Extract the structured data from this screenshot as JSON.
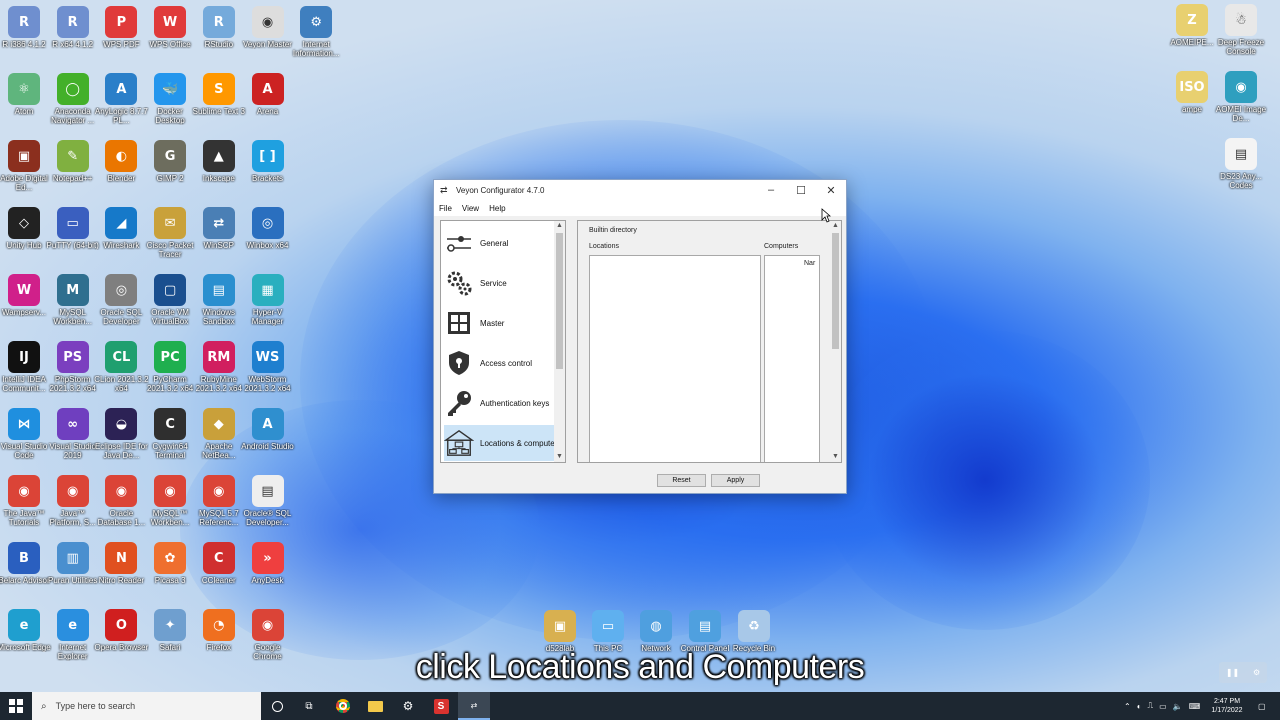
{
  "desktop": {
    "left_icons": [
      {
        "label": "R i386 4.1.2",
        "glyph": "R",
        "color": "#6f8fcf"
      },
      {
        "label": "R x64 4.1.2",
        "glyph": "R",
        "color": "#6f8fcf"
      },
      {
        "label": "WPS PDF",
        "glyph": "P",
        "color": "#e03a3a"
      },
      {
        "label": "WPS Office",
        "glyph": "W",
        "color": "#e03a3a"
      },
      {
        "label": "RStudio",
        "glyph": "R",
        "color": "#75aadb"
      },
      {
        "label": "Veyon Master",
        "glyph": "◉",
        "color": "#dddddd"
      },
      {
        "label": "Internet Information...",
        "glyph": "⚙",
        "color": "#3f7fbf"
      },
      {
        "label": "Atom",
        "glyph": "⚛",
        "color": "#5fb57d"
      },
      {
        "label": "Anaconda Navigator ...",
        "glyph": "◯",
        "color": "#43b02a"
      },
      {
        "label": "AnyLogic 8.7.7 PL...",
        "glyph": "A",
        "color": "#2a7fc9"
      },
      {
        "label": "Docker Desktop",
        "glyph": "🐳",
        "color": "#2496ed"
      },
      {
        "label": "Sublime Text 3",
        "glyph": "S",
        "color": "#ff9800"
      },
      {
        "label": "Arena",
        "glyph": "A",
        "color": "#cc2222"
      },
      {
        "label": "Adobe Digital Ed...",
        "glyph": "▣",
        "color": "#8b2f1e"
      },
      {
        "label": "Notepad++",
        "glyph": "✎",
        "color": "#80b040"
      },
      {
        "label": "Blender",
        "glyph": "◐",
        "color": "#ea7600"
      },
      {
        "label": "GIMP 2",
        "glyph": "G",
        "color": "#6d6d5e"
      },
      {
        "label": "Inkscape",
        "glyph": "▲",
        "color": "#333333"
      },
      {
        "label": "Brackets",
        "glyph": "[ ]",
        "color": "#1fa0e0"
      },
      {
        "label": "Unity Hub",
        "glyph": "◇",
        "color": "#222222"
      },
      {
        "label": "PuTTY (64-bit)",
        "glyph": "▭",
        "color": "#3a5fbf"
      },
      {
        "label": "Wireshark",
        "glyph": "◢",
        "color": "#1679c9"
      },
      {
        "label": "Cisco Packet Tracer",
        "glyph": "✉",
        "color": "#c9a13a"
      },
      {
        "label": "WinSCP",
        "glyph": "⇄",
        "color": "#4a7fb5"
      },
      {
        "label": "Winbox x64",
        "glyph": "◎",
        "color": "#2a6fbf"
      },
      {
        "label": "Wampserv...",
        "glyph": "W",
        "color": "#d0208a"
      },
      {
        "label": "MySQL Workben...",
        "glyph": "M",
        "color": "#2f6f8f"
      },
      {
        "label": "Oracle SQL Developer",
        "glyph": "◎",
        "color": "#7f7f7f"
      },
      {
        "label": "Oracle VM VirtualBox",
        "glyph": "▢",
        "color": "#1a4f8f"
      },
      {
        "label": "Windows Sandbox",
        "glyph": "▤",
        "color": "#2a8fcf"
      },
      {
        "label": "Hyper-V Manager",
        "glyph": "▦",
        "color": "#2aafbf"
      },
      {
        "label": "IntelliJ IDEA Communit...",
        "glyph": "IJ",
        "color": "#111111"
      },
      {
        "label": "PhpStorm 2021.3.2 x64",
        "glyph": "PS",
        "color": "#7b3fbf"
      },
      {
        "label": "CLion 2021.3.2 x64",
        "glyph": "CL",
        "color": "#1f9f6f"
      },
      {
        "label": "PyCharm 2021.3.2 x64",
        "glyph": "PC",
        "color": "#1faf4f"
      },
      {
        "label": "RubyMine 2021.3.2 x64",
        "glyph": "RM",
        "color": "#d11f5f"
      },
      {
        "label": "WebStorm 2021.3.2 x64",
        "glyph": "WS",
        "color": "#1f7fcf"
      },
      {
        "label": "Visual Studio Code",
        "glyph": "⋈",
        "color": "#1f8fdf"
      },
      {
        "label": "Visual Studio 2019",
        "glyph": "∞",
        "color": "#6f3fbf"
      },
      {
        "label": "Eclipse IDE for Java De...",
        "glyph": "◒",
        "color": "#2c2255"
      },
      {
        "label": "Cygwin64 Terminal",
        "glyph": "C",
        "color": "#2f2f2f"
      },
      {
        "label": "Apache NetBea...",
        "glyph": "◆",
        "color": "#c9a03a"
      },
      {
        "label": "Android Studio",
        "glyph": "A",
        "color": "#2f8fcf"
      },
      {
        "label": "The Java™ Tutorials",
        "glyph": "◉",
        "color": "#db4437"
      },
      {
        "label": "Java™ Platform, S...",
        "glyph": "◉",
        "color": "#db4437"
      },
      {
        "label": "Oracle Database 1...",
        "glyph": "◉",
        "color": "#db4437"
      },
      {
        "label": "MySQL™ Workben...",
        "glyph": "◉",
        "color": "#db4437"
      },
      {
        "label": "MySQL 5.7 Referenc...",
        "glyph": "◉",
        "color": "#db4437"
      },
      {
        "label": "Oracle® SQL Developer...",
        "glyph": "▤",
        "color": "#eeeeee"
      },
      {
        "label": "Belarc Advisor",
        "glyph": "B",
        "color": "#2a5fbf"
      },
      {
        "label": "Puran Utilities",
        "glyph": "▥",
        "color": "#4a8fcf"
      },
      {
        "label": "Nitro Reader",
        "glyph": "N",
        "color": "#e05020"
      },
      {
        "label": "Picasa 3",
        "glyph": "✿",
        "color": "#ef6f2f"
      },
      {
        "label": "CCleaner",
        "glyph": "C",
        "color": "#d02f2f"
      },
      {
        "label": "AnyDesk",
        "glyph": "»",
        "color": "#ef3f3f"
      },
      {
        "label": "Microsoft Edge",
        "glyph": "e",
        "color": "#1f9fcf"
      },
      {
        "label": "Internet Explorer",
        "glyph": "e",
        "color": "#2a8fdf"
      },
      {
        "label": "Opera Browser",
        "glyph": "O",
        "color": "#d01f1f"
      },
      {
        "label": "Safari",
        "glyph": "✦",
        "color": "#6f9fcf"
      },
      {
        "label": "Firefox",
        "glyph": "◔",
        "color": "#ef6f1f"
      },
      {
        "label": "Google Chrome",
        "glyph": "◉",
        "color": "#db4437"
      }
    ],
    "right_icons": [
      {
        "label": "AOMEIPE...",
        "glyph": "Z",
        "color": "#e8d070"
      },
      {
        "label": "Deep Freeze Console",
        "glyph": "☃",
        "color": "#e8e8e8"
      },
      {
        "label": "ampe",
        "glyph": "ISO",
        "color": "#e8d070"
      },
      {
        "label": "AOMEI Image De...",
        "glyph": "◉",
        "color": "#2f9fbf"
      },
      {
        "label": "DS23 Any... Codes",
        "glyph": "▤",
        "color": "#f4f4f4"
      }
    ],
    "bottom_icons": [
      {
        "label": "d528lab",
        "glyph": "▣",
        "color": "#d8b050"
      },
      {
        "label": "This PC",
        "glyph": "▭",
        "color": "#5fb0ef"
      },
      {
        "label": "Network",
        "glyph": "◍",
        "color": "#4f9fdf"
      },
      {
        "label": "Control Panel",
        "glyph": "▤",
        "color": "#4fa0df"
      },
      {
        "label": "Recycle Bin",
        "glyph": "♻",
        "color": "#a8c8e8"
      }
    ]
  },
  "window": {
    "title": "Veyon Configurator 4.7.0",
    "menu": [
      "File",
      "View",
      "Help"
    ],
    "nav_items": [
      {
        "label": "General",
        "icon": "toggle-icon",
        "selected": false
      },
      {
        "label": "Service",
        "icon": "gears-icon",
        "selected": false
      },
      {
        "label": "Master",
        "icon": "grid-icon",
        "selected": false
      },
      {
        "label": "Access control",
        "icon": "shield-icon",
        "selected": false
      },
      {
        "label": "Authentication keys",
        "icon": "key-icon",
        "selected": false
      },
      {
        "label": "Locations & computers",
        "icon": "network-icon",
        "selected": true
      }
    ],
    "panel": {
      "group_title": "Builtin directory",
      "locations_label": "Locations",
      "computers_label": "Computers",
      "computers_header": "Nar"
    },
    "buttons": {
      "reset": "Reset",
      "apply": "Apply"
    }
  },
  "taskbar": {
    "search_placeholder": "Type here to search",
    "time": "2:47 PM",
    "date": "1/17/2022"
  },
  "caption": "click Locations and Computers"
}
